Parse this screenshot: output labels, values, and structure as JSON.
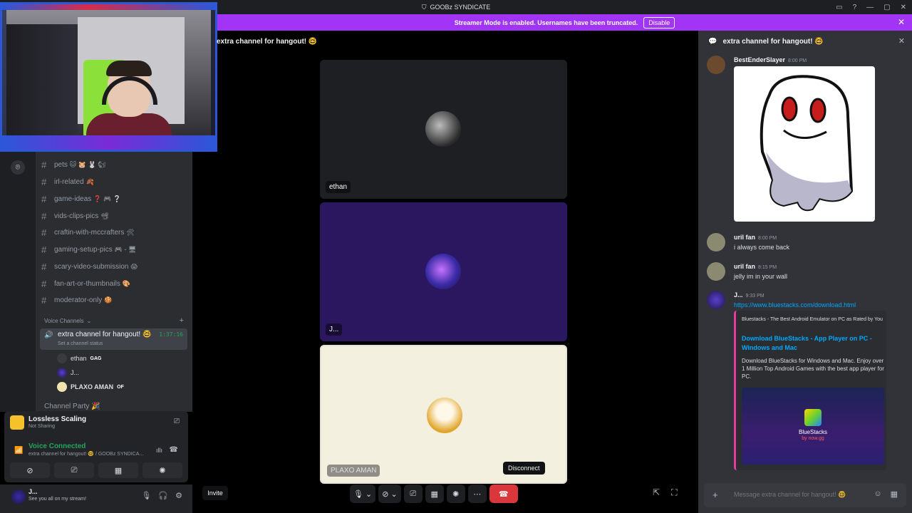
{
  "titlebar": {
    "server_name": "GOOBz SYNDICATE"
  },
  "banner": {
    "text": "Streamer Mode is enabled. Usernames have been truncated.",
    "disable_label": "Disable"
  },
  "text_channels": [
    {
      "name": "pets",
      "emoji": "🐱 🐹 🐰 🐿"
    },
    {
      "name": "irl-related",
      "emoji": "🍂"
    },
    {
      "name": "game-ideas",
      "emoji": "❓ 🎮 ❔"
    },
    {
      "name": "vids-clips-pics",
      "emoji": "📽"
    },
    {
      "name": "craftin-with-mccrafters",
      "emoji": "🛠"
    },
    {
      "name": "gaming-setup-pics",
      "emoji": "🎮 - 🖥"
    },
    {
      "name": "scary-video-submission",
      "emoji": "😱"
    },
    {
      "name": "fan-art-or-thumbnails",
      "emoji": "🎨"
    },
    {
      "name": "moderator-only",
      "emoji": "🍪"
    }
  ],
  "voice_section": {
    "label": "Voice Channels",
    "add": "+"
  },
  "active_voice": {
    "name": "extra channel for hangout! 🤓",
    "time": "1:37:16",
    "status": "Set a channel status"
  },
  "voice_users": [
    {
      "name": "ethan",
      "tag": "GAG"
    },
    {
      "name": "J...",
      "tag": ""
    },
    {
      "name": "PLAXO AMAN",
      "tag": "OF"
    }
  ],
  "next_channel": "Channel Party 🎉",
  "panel": {
    "activity_title": "Lossless Scaling",
    "activity_sub": "Not Sharing",
    "voice_title": "Voice Connected",
    "voice_sub": "extra channel for hangout! 🤓 / GOOBz SYNDICA..."
  },
  "user": {
    "name": "J...",
    "status": "See you all on my stream!"
  },
  "stage": {
    "title": "extra channel for hangout! 🤓",
    "tiles": [
      {
        "name": "ethan"
      },
      {
        "name": "J..."
      },
      {
        "name": "PLAXO AMAN"
      }
    ],
    "invite_label": "Invite",
    "tooltip": "Disconnect"
  },
  "chat": {
    "title": "extra channel for hangout! 🤓",
    "messages": [
      {
        "author": "BestEnderSlayer",
        "time": "8:00 PM"
      },
      {
        "author": "uril fan",
        "time": "8:00 PM",
        "text": "i always come back"
      },
      {
        "author": "uril fan",
        "time": "8:15 PM",
        "text": "jelly im in your wall"
      },
      {
        "author": "J...",
        "time": "9:33 PM",
        "link": "https://www.bluestacks.com/download.html"
      }
    ],
    "embed": {
      "provider": "Bluestacks - The Best Android Emulator on PC as Rated by You",
      "title": "Download BlueStacks - App Player on PC - Windows and Mac",
      "description": "Download BlueStacks for Windows and Mac. Enjoy over 1 Million Top Android Games with the best app player for PC.",
      "image_name": "BlueStacks",
      "image_by": "by now.gg"
    },
    "composer_placeholder": "Message extra channel for hangout! 🤓"
  },
  "colors": {
    "accent": "#a235f5",
    "voice_green": "#23a55a",
    "disconnect_red": "#da373c",
    "link": "#00a8fc"
  }
}
